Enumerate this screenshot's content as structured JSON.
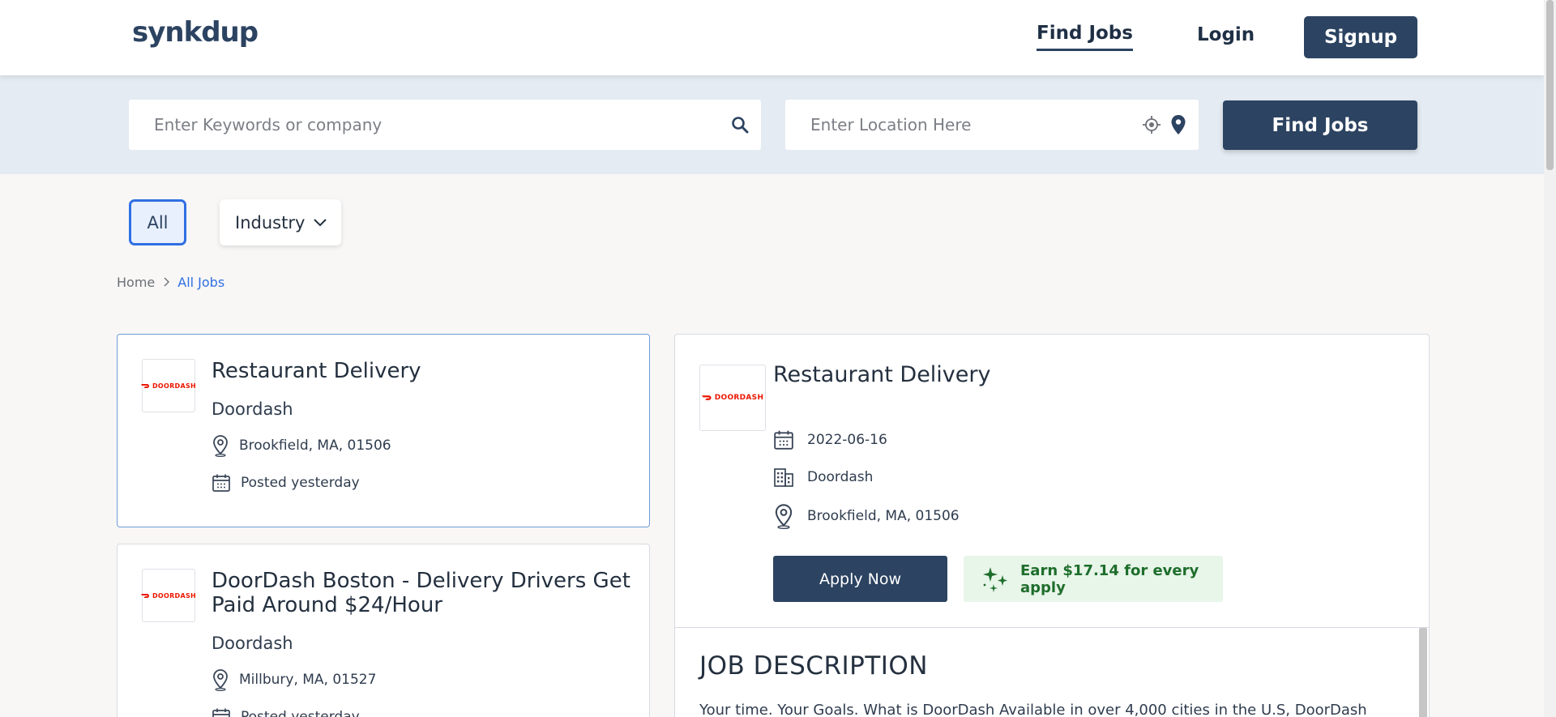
{
  "header": {
    "logo": "synkdup",
    "nav": {
      "find_jobs": "Find Jobs",
      "login": "Login",
      "signup": "Signup"
    }
  },
  "search": {
    "keywords_placeholder": "Enter Keywords or company",
    "location_placeholder": "Enter Location Here",
    "button": "Find Jobs"
  },
  "filters": {
    "all": "All",
    "industry": "Industry"
  },
  "breadcrumb": {
    "home": "Home",
    "separator": ">",
    "current": "All Jobs"
  },
  "jobs": [
    {
      "title": "Restaurant Delivery",
      "company": "Doordash",
      "location": "Brookfield, MA, 01506",
      "posted": "Posted yesterday",
      "logo_text": "DOORDASH"
    },
    {
      "title": "DoorDash Boston - Delivery Drivers Get Paid Around $24/Hour",
      "company": "Doordash",
      "location": "Millbury, MA, 01527",
      "posted": "Posted yesterday",
      "logo_text": "DOORDASH"
    }
  ],
  "detail": {
    "logo_text": "DOORDASH",
    "title": "Restaurant Delivery",
    "date": "2022-06-16",
    "company": "Doordash",
    "location": "Brookfield, MA, 01506",
    "apply_button": "Apply Now",
    "earn_text": "Earn $17.14 for every apply",
    "description_heading": "JOB DESCRIPTION",
    "description_text": "Your time. Your Goals. What is DoorDash Available in over 4,000 cities in the U.S, DoorDash"
  },
  "colors": {
    "brand_navy": "#2c4361",
    "accent_blue": "#2f6fe3",
    "doordash_red": "#eb1700",
    "earn_green": "#1e6e2c",
    "earn_bg": "#e8f5e9"
  },
  "icons": [
    "search-icon",
    "crosshair-icon",
    "map-pin-icon",
    "chevron-down-icon",
    "chevron-right-icon",
    "location-pin-icon",
    "calendar-icon",
    "building-icon",
    "sparkle-icon"
  ]
}
